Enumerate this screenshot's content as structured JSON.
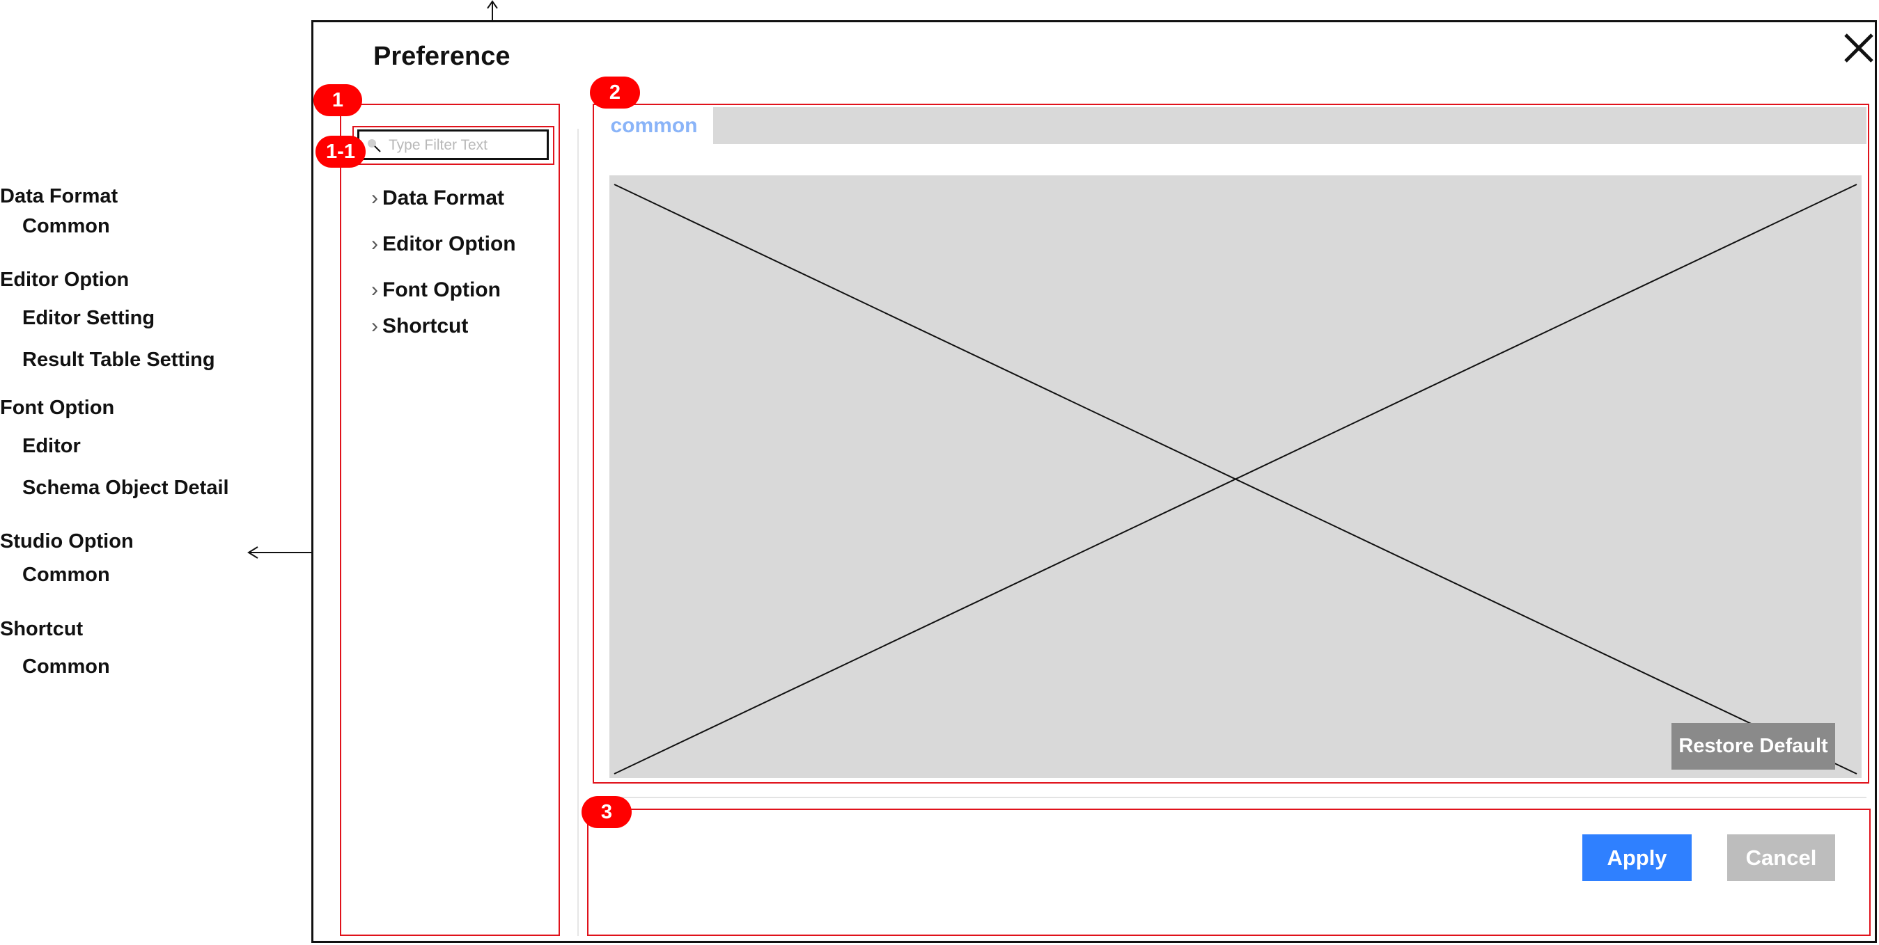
{
  "window": {
    "title": "Preference",
    "close_icon": "close-icon"
  },
  "outline": [
    {
      "label": "Data Format",
      "children": [
        "Common"
      ]
    },
    {
      "label": "Editor Option",
      "children": [
        "Editor Setting",
        "Result Table Setting"
      ]
    },
    {
      "label": "Font Option",
      "children": [
        "Editor",
        "Schema Object Detail"
      ]
    },
    {
      "label": "Studio Option",
      "children": [
        "Common"
      ]
    },
    {
      "label": "Shortcut",
      "children": [
        "Common"
      ]
    }
  ],
  "badges": {
    "b1": "1",
    "b1_1": "1-1",
    "b2": "2",
    "b3": "3"
  },
  "filter": {
    "placeholder": "Type Filter  Text",
    "icon": "search-icon"
  },
  "tree": {
    "items": [
      {
        "label": "Data Format"
      },
      {
        "label": "Editor Option"
      },
      {
        "label": "Font Option"
      },
      {
        "label": "Shortcut"
      }
    ]
  },
  "content": {
    "tab_label": "common",
    "restore_label": "Restore Default"
  },
  "footer": {
    "apply_label": "Apply",
    "cancel_label": "Cancel"
  },
  "colors": {
    "annotation_red": "#ff0000",
    "apply_blue": "#2f80ff",
    "cancel_gray": "#bdbdbd",
    "restore_gray": "#8a8a8a",
    "placeholder_fill": "#d9d9d9",
    "tab_text": "#8ab4f8"
  }
}
